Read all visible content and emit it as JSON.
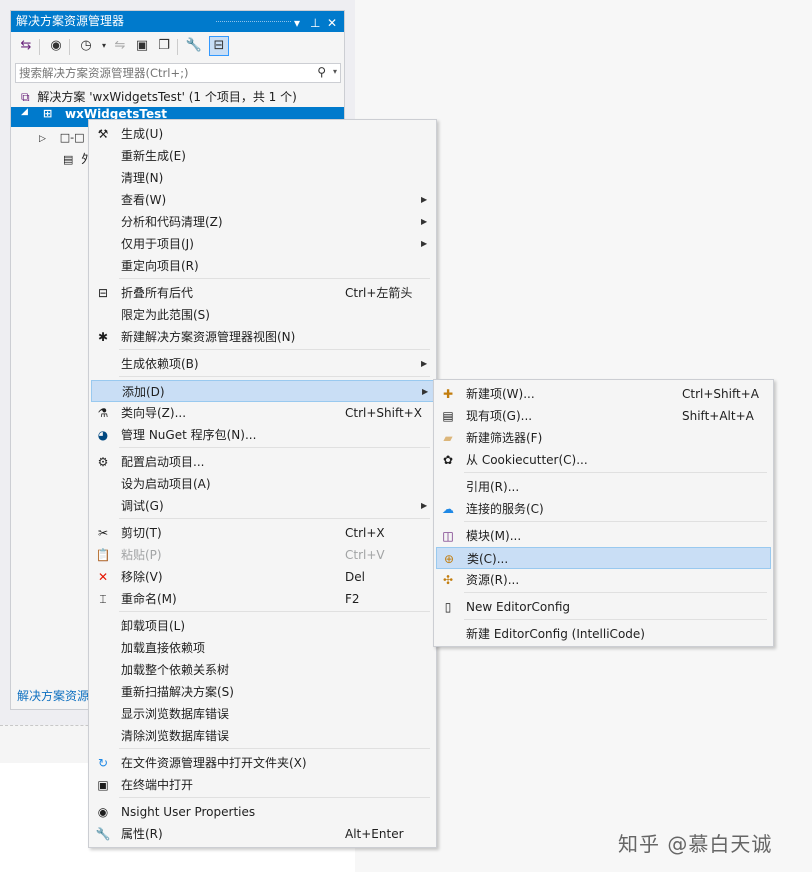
{
  "panel": {
    "title": "解决方案资源管理器",
    "search_placeholder": "搜索解决方案资源管理器(Ctrl+;)",
    "tree": {
      "solution": "解决方案 'wxWidgetsTest' (1 个项目，共 1 个)",
      "project": "wxWidgetsTest",
      "node1_prefix": "□-□",
      "node2_prefix": "外"
    },
    "footer": "解决方案资源"
  },
  "context_menu": {
    "items": [
      {
        "label": "生成(U)",
        "icon": "build-icon",
        "sc": "",
        "arrow": false
      },
      {
        "label": "重新生成(E)",
        "icon": "",
        "sc": "",
        "arrow": false
      },
      {
        "label": "清理(N)",
        "icon": "",
        "sc": "",
        "arrow": false
      },
      {
        "label": "查看(W)",
        "icon": "",
        "sc": "",
        "arrow": true
      },
      {
        "label": "分析和代码清理(Z)",
        "icon": "",
        "sc": "",
        "arrow": true
      },
      {
        "label": "仅用于项目(J)",
        "icon": "",
        "sc": "",
        "arrow": true
      },
      {
        "label": "重定向项目(R)",
        "icon": "",
        "sc": "",
        "arrow": false
      },
      {
        "label": "折叠所有后代",
        "icon": "collapse-icon",
        "sc": "Ctrl+左箭头",
        "arrow": false
      },
      {
        "label": "限定为此范围(S)",
        "icon": "",
        "sc": "",
        "arrow": false
      },
      {
        "label": "新建解决方案资源管理器视图(N)",
        "icon": "new-view-icon",
        "sc": "",
        "arrow": false
      },
      {
        "label": "生成依赖项(B)",
        "icon": "",
        "sc": "",
        "arrow": true
      },
      {
        "label": "添加(D)",
        "icon": "",
        "sc": "",
        "arrow": true
      },
      {
        "label": "类向导(Z)...",
        "icon": "class-wizard-icon",
        "sc": "Ctrl+Shift+X",
        "arrow": false
      },
      {
        "label": "管理 NuGet 程序包(N)...",
        "icon": "nuget-icon",
        "sc": "",
        "arrow": false
      },
      {
        "label": "配置启动项目...",
        "icon": "gear-icon",
        "sc": "",
        "arrow": false
      },
      {
        "label": "设为启动项目(A)",
        "icon": "",
        "sc": "",
        "arrow": false
      },
      {
        "label": "调试(G)",
        "icon": "",
        "sc": "",
        "arrow": true
      },
      {
        "label": "剪切(T)",
        "icon": "scissors-icon",
        "sc": "Ctrl+X",
        "arrow": false
      },
      {
        "label": "粘贴(P)",
        "icon": "paste-icon",
        "sc": "Ctrl+V",
        "arrow": false
      },
      {
        "label": "移除(V)",
        "icon": "remove-icon",
        "sc": "Del",
        "arrow": false
      },
      {
        "label": "重命名(M)",
        "icon": "rename-icon",
        "sc": "F2",
        "arrow": false
      },
      {
        "label": "卸载项目(L)",
        "icon": "",
        "sc": "",
        "arrow": false
      },
      {
        "label": "加载直接依赖项",
        "icon": "",
        "sc": "",
        "arrow": false
      },
      {
        "label": "加载整个依赖关系树",
        "icon": "",
        "sc": "",
        "arrow": false
      },
      {
        "label": "重新扫描解决方案(S)",
        "icon": "",
        "sc": "",
        "arrow": false
      },
      {
        "label": "显示浏览数据库错误",
        "icon": "",
        "sc": "",
        "arrow": false
      },
      {
        "label": "清除浏览数据库错误",
        "icon": "",
        "sc": "",
        "arrow": false
      },
      {
        "label": "在文件资源管理器中打开文件夹(X)",
        "icon": "open-folder-icon",
        "sc": "",
        "arrow": false
      },
      {
        "label": "在终端中打开",
        "icon": "terminal-icon",
        "sc": "",
        "arrow": false
      },
      {
        "label": "Nsight User Properties",
        "icon": "nsight-icon",
        "sc": "",
        "arrow": false
      },
      {
        "label": "属性(R)",
        "icon": "wrench-icon",
        "sc": "Alt+Enter",
        "arrow": false
      }
    ]
  },
  "submenu": {
    "items": [
      {
        "label": "新建项(W)...",
        "icon": "new-item-icon",
        "sc": "Ctrl+Shift+A"
      },
      {
        "label": "现有项(G)...",
        "icon": "existing-item-icon",
        "sc": "Shift+Alt+A"
      },
      {
        "label": "新建筛选器(F)",
        "icon": "filter-folder-icon",
        "sc": ""
      },
      {
        "label": "从 Cookiecutter(C)...",
        "icon": "cookiecutter-icon",
        "sc": ""
      },
      {
        "label": "引用(R)...",
        "icon": "",
        "sc": ""
      },
      {
        "label": "连接的服务(C)",
        "icon": "connected-service-icon",
        "sc": ""
      },
      {
        "label": "模块(M)...",
        "icon": "module-icon",
        "sc": ""
      },
      {
        "label": "类(C)...",
        "icon": "class-icon",
        "sc": ""
      },
      {
        "label": "资源(R)...",
        "icon": "resource-icon",
        "sc": ""
      },
      {
        "label": "New EditorConfig",
        "icon": "document-icon",
        "sc": ""
      },
      {
        "label": "新建 EditorConfig (IntelliCode)",
        "icon": "",
        "sc": ""
      }
    ]
  },
  "watermark": "知乎 @慕白天诚"
}
